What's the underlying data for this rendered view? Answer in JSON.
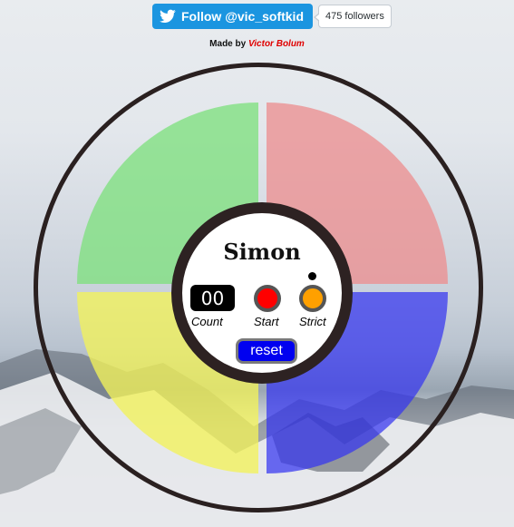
{
  "twitter": {
    "follow_label": "Follow @vic_softkid",
    "followers_label": "475 followers",
    "icon": "twitter-bird-icon"
  },
  "credit": {
    "prefix": "Made by",
    "author": "Victor Bolum"
  },
  "game": {
    "title": "Simon",
    "count": "00",
    "count_label": "Count",
    "start_label": "Start",
    "strict_label": "Strict",
    "reset_label": "reset",
    "pads": [
      {
        "name": "green",
        "color": "#7fe07f"
      },
      {
        "name": "red",
        "color": "#ec8f91"
      },
      {
        "name": "yellow",
        "color": "#f2f25a"
      },
      {
        "name": "blue",
        "color": "#3434f0"
      }
    ],
    "start_button_color": "#ff0000",
    "strict_button_color": "#ffa000",
    "reset_button_color": "#0000f0"
  }
}
